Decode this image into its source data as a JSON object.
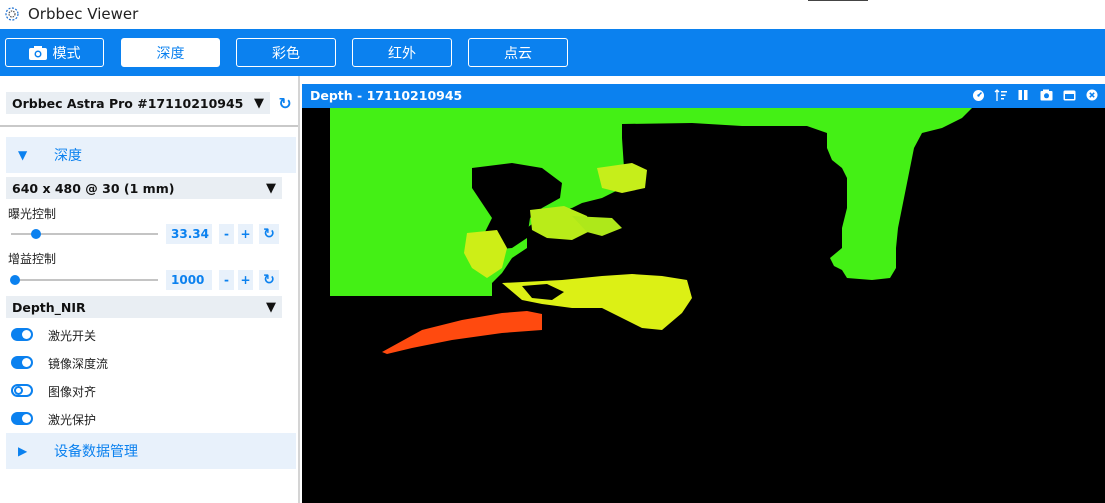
{
  "window": {
    "title": "Orbbec Viewer"
  },
  "tabs": [
    {
      "label": "模式",
      "icon": "camera-icon",
      "active": false
    },
    {
      "label": "深度",
      "active": true
    },
    {
      "label": "彩色",
      "active": false
    },
    {
      "label": "红外",
      "active": false
    },
    {
      "label": "点云",
      "active": false
    }
  ],
  "device": {
    "name": "Orbbec Astra Pro #17110210945"
  },
  "depth_section": {
    "title": "深度",
    "resolution": "640 x 480 @ 30 (1 mm)",
    "exposure": {
      "label": "曝光控制",
      "value": "33.34",
      "minus": "-",
      "plus": "+",
      "fraction": 0.1
    },
    "gain": {
      "label": "增益控制",
      "value": "1000",
      "minus": "-",
      "plus": "+",
      "fraction": 0.0
    },
    "stream_mode": "Depth_NIR",
    "toggles": [
      {
        "label": "激光开关",
        "on": true
      },
      {
        "label": "镜像深度流",
        "on": true
      },
      {
        "label": "图像对齐",
        "on": false
      },
      {
        "label": "激光保护",
        "on": true
      }
    ]
  },
  "device_data_section": {
    "title": "设备数据管理"
  },
  "viewer": {
    "title": "Depth - 17110210945",
    "icons": [
      "gauge-icon",
      "sort-icon",
      "pause-icon",
      "snapshot-icon",
      "maximize-icon",
      "close-icon"
    ]
  },
  "colors": {
    "accent": "#0b81ef",
    "depth_near": "#ff4a0f",
    "depth_mid": "#d6f215",
    "depth_far": "#44f015"
  }
}
